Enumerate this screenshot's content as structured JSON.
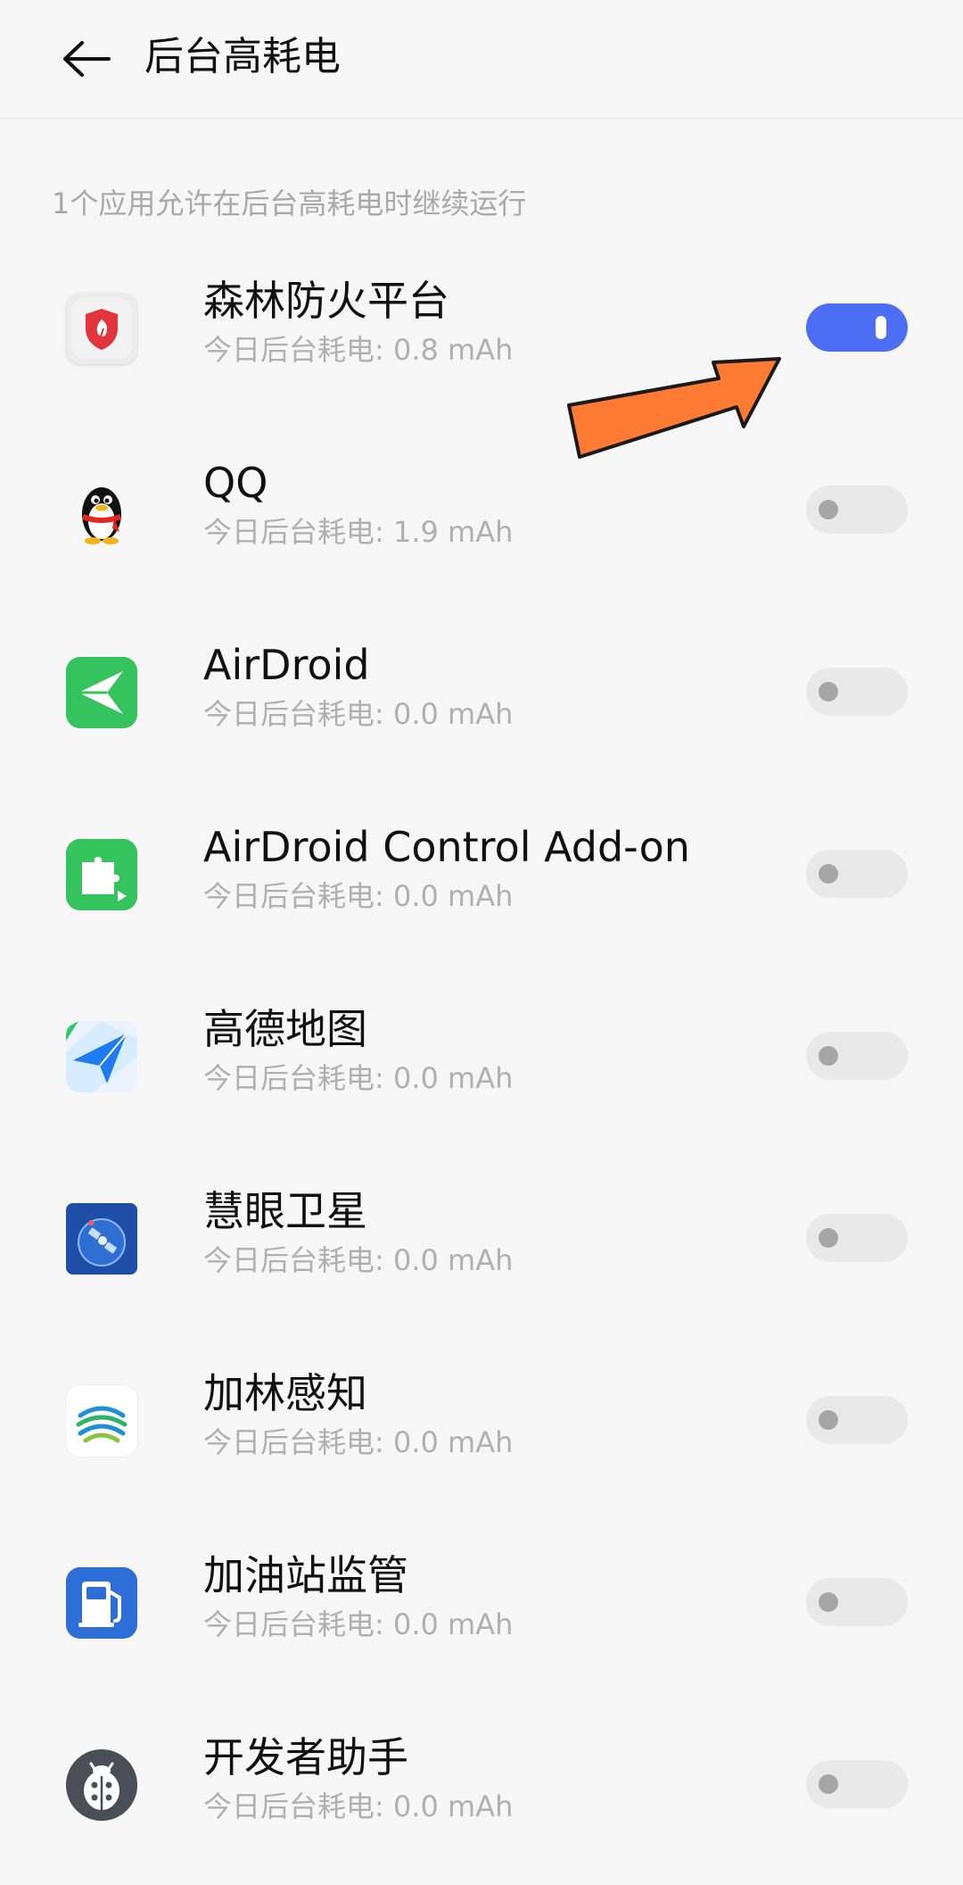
{
  "header": {
    "title": "后台高耗电"
  },
  "subtitle": "1个应用允许在后台高耗电时继续运行",
  "apps": [
    {
      "name": "森林防火平台",
      "usage": "今日后台耗电: 0.8 mAh",
      "icon": "shield-leaf-icon",
      "enabled": true
    },
    {
      "name": "QQ",
      "usage": "今日后台耗电: 1.9 mAh",
      "icon": "penguin-icon",
      "enabled": false
    },
    {
      "name": "AirDroid",
      "usage": "今日后台耗电: 0.0 mAh",
      "icon": "paper-plane-icon",
      "enabled": false
    },
    {
      "name": "AirDroid Control Add-on",
      "usage": "今日后台耗电: 0.0 mAh",
      "icon": "puzzle-icon",
      "enabled": false
    },
    {
      "name": "高德地图",
      "usage": "今日后台耗电: 0.0 mAh",
      "icon": "navigation-arrow-icon",
      "enabled": false
    },
    {
      "name": "慧眼卫星",
      "usage": "今日后台耗电: 0.0 mAh",
      "icon": "satellite-icon",
      "enabled": false
    },
    {
      "name": "加林感知",
      "usage": "今日后台耗电: 0.0 mAh",
      "icon": "china-mobile-icon",
      "enabled": false
    },
    {
      "name": "加油站监管",
      "usage": "今日后台耗电: 0.0 mAh",
      "icon": "fuel-pump-icon",
      "enabled": false
    },
    {
      "name": "开发者助手",
      "usage": "今日后台耗电: 0.0 mAh",
      "icon": "ladybug-icon",
      "enabled": false
    }
  ],
  "colors": {
    "toggle_on": "#4b6ef5",
    "toggle_off": "#e9e9e9",
    "annotation_arrow": "#ff7a33"
  }
}
